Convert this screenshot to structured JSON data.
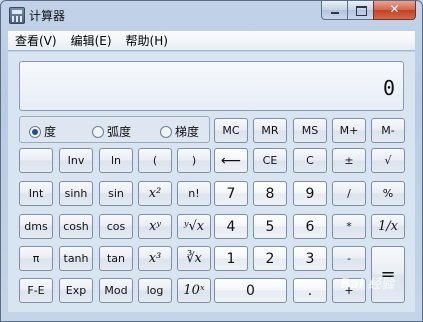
{
  "window": {
    "title": "计算器"
  },
  "menu": [
    "查看(V)",
    "编辑(E)",
    "帮助(H)"
  ],
  "display": {
    "value": "0"
  },
  "angle": [
    "度",
    "弧度",
    "梯度"
  ],
  "memory": [
    "MC",
    "MR",
    "MS",
    "M+",
    "M-"
  ],
  "row1": [
    "",
    "Inv",
    "ln",
    "(",
    ")",
    "⟵",
    "CE",
    "C",
    "±",
    "√"
  ],
  "row2": [
    "Int",
    "sinh",
    "sin",
    "x²",
    "n!",
    "7",
    "8",
    "9",
    "/",
    "%"
  ],
  "row3": [
    "dms",
    "cosh",
    "cos",
    "xʸ",
    "ʸ√x",
    "4",
    "5",
    "6",
    "*",
    "1/x"
  ],
  "row4": [
    "π",
    "tanh",
    "tan",
    "x³",
    "∛x",
    "1",
    "2",
    "3",
    "-",
    "="
  ],
  "row5": [
    "F-E",
    "Exp",
    "Mod",
    "log",
    "10ˣ",
    "0",
    ".",
    "+"
  ],
  "watermark": "Bai 经验"
}
